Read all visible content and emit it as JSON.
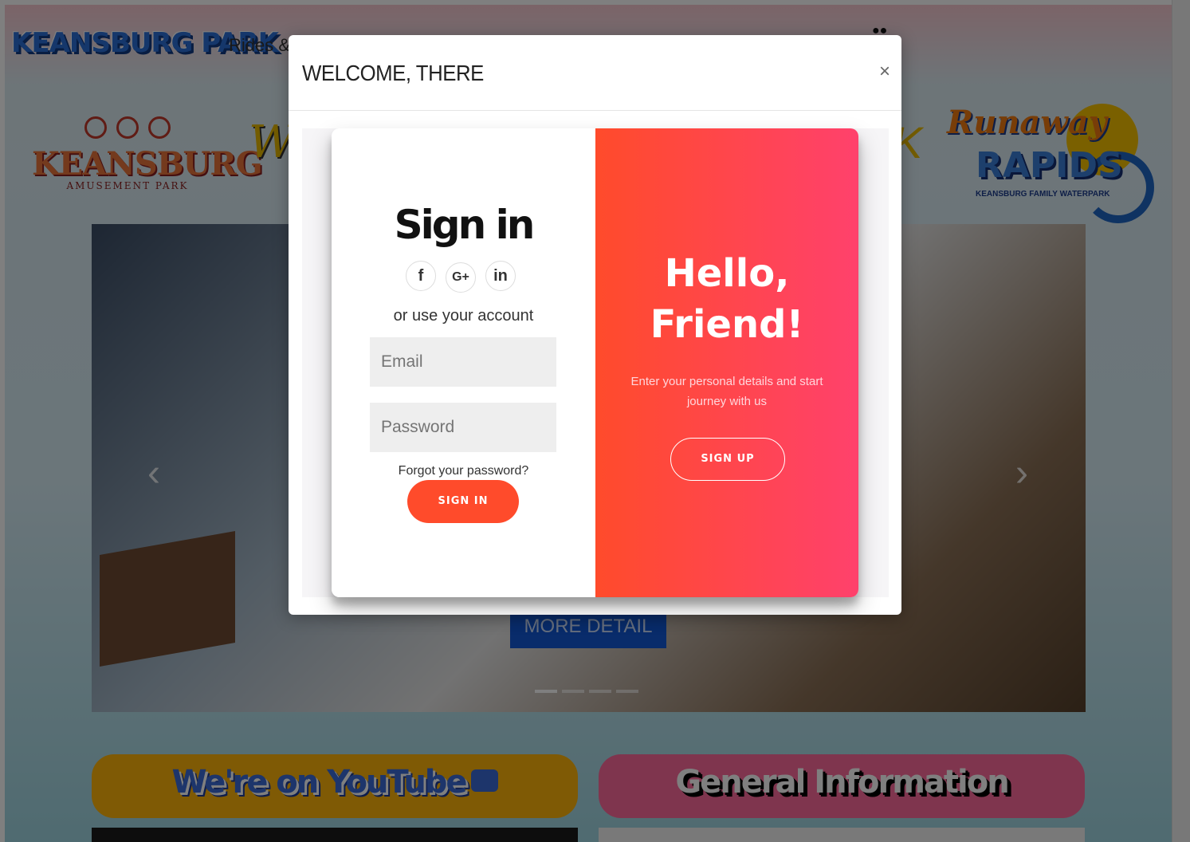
{
  "header": {
    "brand": "KEANSBURG PARK",
    "nav_rides": "Rides &",
    "icon": "paw-icon"
  },
  "logos": {
    "keansburg_title": "KEANSBURG",
    "keansburg_sub": "AMUSEMENT PARK",
    "runaway_title": "Runaway",
    "runaway_title2": "RAPIDS",
    "runaway_sub": "KEANSBURG FAMILY WATERPARK"
  },
  "hero": {
    "more_detail": "MORE DETAIL",
    "prev_icon": "chevron-left-icon",
    "next_icon": "chevron-right-icon",
    "indicator_count": 4,
    "active_indicator": 0
  },
  "tiles": {
    "youtube": "We're on YouTube",
    "general": "General Information"
  },
  "modal": {
    "title": "WELCOME, THERE",
    "close": "×",
    "signin": {
      "title": "Sign in",
      "socials": [
        "f",
        "G+",
        "in"
      ],
      "or_text": "or use your account",
      "email_placeholder": "Email",
      "password_placeholder": "Password",
      "forgot": "Forgot your password?",
      "button": "SIGN IN"
    },
    "hello": {
      "title": "Hello, Friend!",
      "subtitle": "Enter your personal details and start journey with us",
      "button": "SIGN UP"
    }
  },
  "colors": {
    "accent_red": "#ff4b2b",
    "accent_pink": "#ff416c",
    "youtube_tile": "#ffb40b",
    "info_tile": "#ff6a9c",
    "more_detail_blue": "#1358d6"
  }
}
